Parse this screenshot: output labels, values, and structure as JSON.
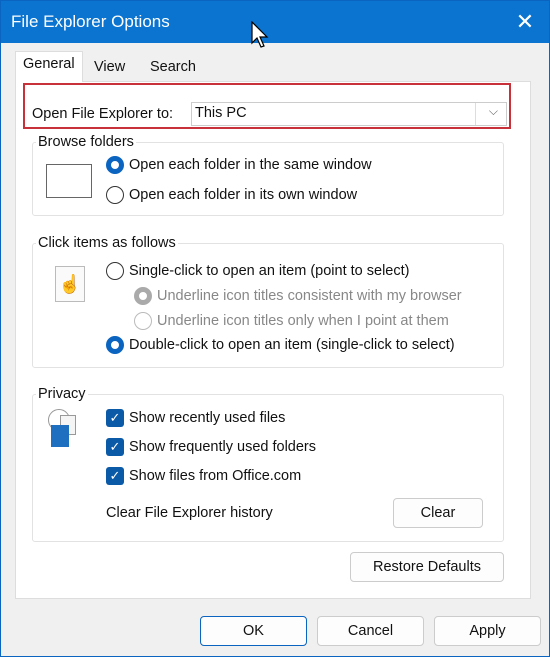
{
  "window": {
    "title": "File Explorer Options",
    "close_icon": "close-icon"
  },
  "tabs": [
    {
      "label": "General",
      "active": true
    },
    {
      "label": "View"
    },
    {
      "label": "Search"
    }
  ],
  "open_to": {
    "label": "Open File Explorer to:",
    "value": "This PC"
  },
  "browse": {
    "title": "Browse folders",
    "options": [
      {
        "label": "Open each folder in the same window",
        "selected": true
      },
      {
        "label": "Open each folder in its own window",
        "selected": false
      }
    ]
  },
  "click": {
    "title": "Click items as follows",
    "options": [
      {
        "label": "Single-click to open an item (point to select)",
        "selected": false
      },
      {
        "label": "Underline icon titles consistent with my browser",
        "selected": true,
        "disabled": true
      },
      {
        "label": "Underline icon titles only when I point at them",
        "selected": false,
        "disabled": true
      },
      {
        "label": "Double-click to open an item (single-click to select)",
        "selected": true
      }
    ]
  },
  "privacy": {
    "title": "Privacy",
    "checks": [
      {
        "label": "Show recently used files",
        "checked": true
      },
      {
        "label": "Show frequently used folders",
        "checked": true
      },
      {
        "label": "Show files from Office.com",
        "checked": true
      }
    ],
    "clear_label": "Clear File Explorer history",
    "clear_button": "Clear"
  },
  "restore_button": "Restore Defaults",
  "footer": {
    "ok": "OK",
    "cancel": "Cancel",
    "apply": "Apply"
  },
  "colors": {
    "titlebar": "#0a74d0",
    "accent": "#0a64c0",
    "highlight": "#c8303a"
  }
}
